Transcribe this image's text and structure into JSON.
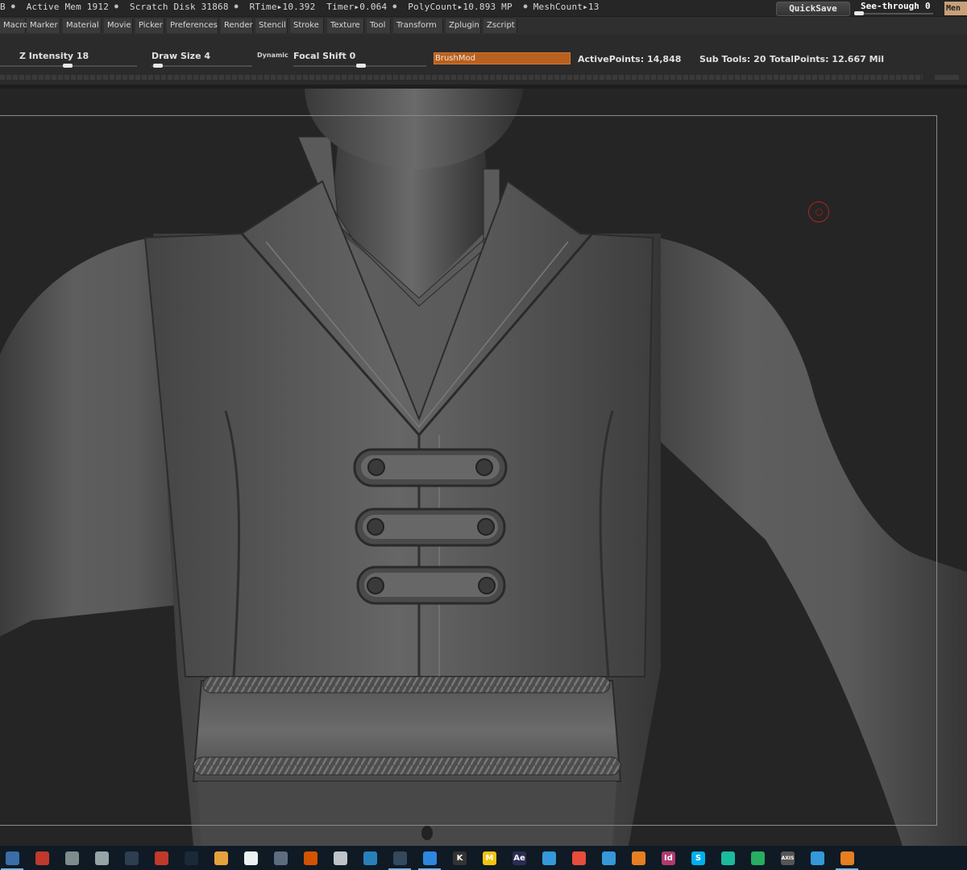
{
  "status_bar": {
    "items": [
      "B",
      "Active Mem 1912",
      "Scratch Disk 31868",
      "RTime▸10.392",
      "Timer▸0.064",
      "PolyCount▸10.893 MP",
      "MeshCount▸13"
    ],
    "quicksave_label": "QuickSave",
    "see_through_label": "See-through",
    "see_through_value": "0",
    "menus_label": "Men"
  },
  "menubar": {
    "items": [
      "Macro",
      "Marker",
      "Material",
      "Movie",
      "Picker",
      "Preferences",
      "Render",
      "Stencil",
      "Stroke",
      "Texture",
      "Tool",
      "Transform",
      "Zplugin",
      "Zscript"
    ]
  },
  "tool_options": {
    "z_intensity_label": "Z Intensity",
    "z_intensity_value": "18",
    "draw_size_label": "Draw Size",
    "draw_size_value": "4",
    "dynamic_label": "Dynamic",
    "focal_shift_label": "Focal Shift",
    "focal_shift_value": "0",
    "brushmod_label": "BrushMod",
    "active_points": "ActivePoints: 14,848",
    "sub_tools": "Sub Tools: 20",
    "total_points": "TotalPoints: 12.667  Mil"
  },
  "viewport": {
    "subject": "sculpted character torso with vest, strap buttons and rope belt"
  },
  "taskbar": {
    "apps": [
      {
        "name": "explorer-icon",
        "glyph": "",
        "color": "#3a6ea8"
      },
      {
        "name": "record-icon",
        "glyph": "",
        "color": "#c0392b"
      },
      {
        "name": "tool-icon",
        "glyph": "",
        "color": "#7f8c8d"
      },
      {
        "name": "notes-icon",
        "glyph": "",
        "color": "#95a5a6"
      },
      {
        "name": "arrows-icon",
        "glyph": "",
        "color": "#2c3e50"
      },
      {
        "name": "antivirus-icon",
        "glyph": "",
        "color": "#c0392b"
      },
      {
        "name": "steam-icon",
        "glyph": "",
        "color": "#1b2838"
      },
      {
        "name": "folder-icon",
        "glyph": "",
        "color": "#e6a23c"
      },
      {
        "name": "microphone-icon",
        "glyph": "",
        "color": "#ecf0f1"
      },
      {
        "name": "globe-icon",
        "glyph": "",
        "color": "#5d6d7e"
      },
      {
        "name": "winrar-icon",
        "glyph": "",
        "color": "#d35400"
      },
      {
        "name": "unity-icon",
        "glyph": "",
        "color": "#bdc3c7"
      },
      {
        "name": "sourcetree-icon",
        "glyph": "",
        "color": "#2980b9"
      },
      {
        "name": "obs-icon",
        "glyph": "",
        "color": "#34495e"
      },
      {
        "name": "vscode-icon",
        "glyph": "",
        "color": "#2e86de"
      },
      {
        "name": "k-app-icon",
        "glyph": "K",
        "color": "#333333"
      },
      {
        "name": "m-app-icon",
        "glyph": "M",
        "color": "#f1c40f"
      },
      {
        "name": "after-effects-icon",
        "glyph": "Ae",
        "color": "#2c2c54"
      },
      {
        "name": "flask-icon",
        "glyph": "",
        "color": "#3498db"
      },
      {
        "name": "camera-icon",
        "glyph": "",
        "color": "#e74c3c"
      },
      {
        "name": "chrome-icon",
        "glyph": "",
        "color": "#3498db"
      },
      {
        "name": "photo-app-icon",
        "glyph": "",
        "color": "#e67e22"
      },
      {
        "name": "indesign-icon",
        "glyph": "Id",
        "color": "#b03a6d"
      },
      {
        "name": "skype-icon",
        "glyph": "S",
        "color": "#00aff0"
      },
      {
        "name": "blender-icon",
        "glyph": "",
        "color": "#1abc9c"
      },
      {
        "name": "monitor-icon",
        "glyph": "",
        "color": "#27ae60"
      },
      {
        "name": "axis-app-icon",
        "glyph": "AXIS",
        "color": "#555555"
      },
      {
        "name": "browser-icon",
        "glyph": "",
        "color": "#3498db"
      },
      {
        "name": "zbrush-icon",
        "glyph": "",
        "color": "#e67e22"
      }
    ]
  }
}
